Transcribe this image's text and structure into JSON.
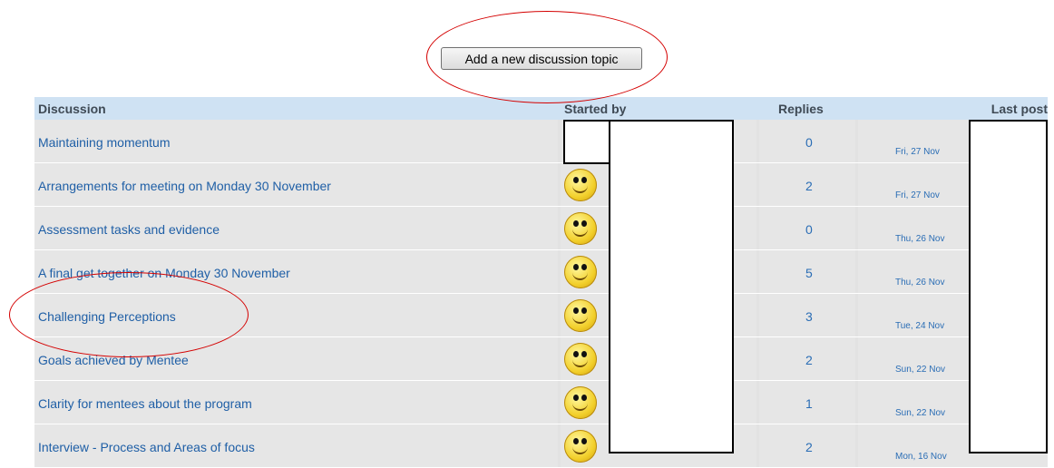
{
  "add_button": {
    "label": "Add a new discussion topic"
  },
  "table": {
    "headers": {
      "discussion": "Discussion",
      "started_by": "Started by",
      "replies": "Replies",
      "last_post": "Last post"
    },
    "rows": [
      {
        "topic": "Maintaining momentum",
        "replies": "0",
        "last_post": "Fri, 27 Nov"
      },
      {
        "topic": "Arrangements for meeting on Monday 30 November",
        "replies": "2",
        "last_post": "Fri, 27 Nov"
      },
      {
        "topic": "Assessment tasks and evidence",
        "replies": "0",
        "last_post": "Thu, 26 Nov"
      },
      {
        "topic": "A final get together on Monday 30 November",
        "replies": "5",
        "last_post": "Thu, 26 Nov"
      },
      {
        "topic": "Challenging Perceptions",
        "replies": "3",
        "last_post": "Tue, 24 Nov"
      },
      {
        "topic": "Goals achieved by Mentee",
        "replies": "2",
        "last_post": "Sun, 22 Nov"
      },
      {
        "topic": "Clarity for mentees about the program",
        "replies": "1",
        "last_post": "Sun, 22 Nov"
      },
      {
        "topic": "Interview - Process and Areas of focus",
        "replies": "2",
        "last_post": "Mon, 16 Nov"
      }
    ]
  },
  "icons": {
    "avatar": "smiley-avatar-icon"
  },
  "colors": {
    "header_bg": "#cfe2f3",
    "row_bg": "#e6e6e6",
    "link": "#1f5fa6",
    "annotation": "#d40000"
  }
}
